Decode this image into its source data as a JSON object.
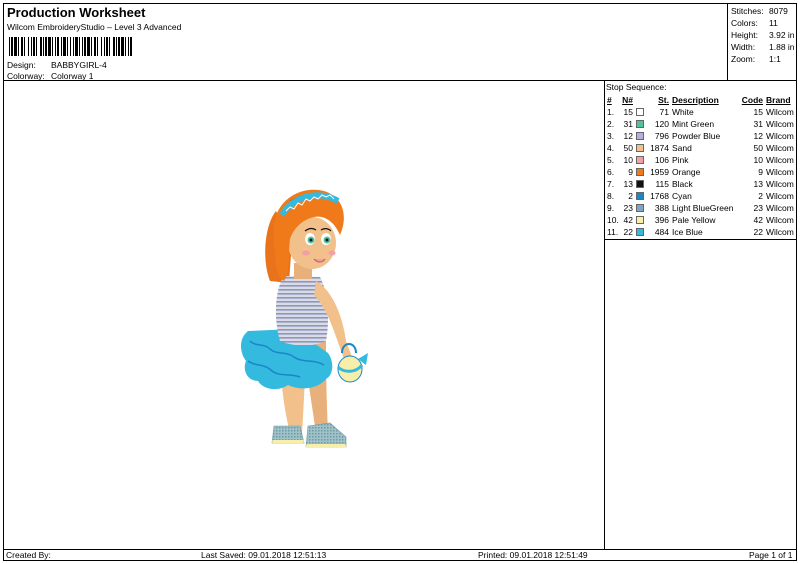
{
  "header": {
    "title": "Production Worksheet",
    "subtitle": "Wilcom EmbroideryStudio – Level 3 Advanced",
    "design_label": "Design:",
    "design_value": "BABBYGIRL-4",
    "colorway_label": "Colorway:",
    "colorway_value": "Colorway 1"
  },
  "stats": {
    "stitches_label": "Stitches:",
    "stitches_value": "8079",
    "colors_label": "Colors:",
    "colors_value": "11",
    "height_label": "Height:",
    "height_value": "3.92 in",
    "width_label": "Width:",
    "width_value": "1.88 in",
    "zoom_label": "Zoom:",
    "zoom_value": "1:1"
  },
  "sequence": {
    "title": "Stop Sequence:",
    "headers": {
      "idx": "#",
      "n": "N#",
      "st": "St.",
      "desc": "Description",
      "code": "Code",
      "brand": "Brand"
    },
    "rows": [
      {
        "idx": "1.",
        "n": "15",
        "color": "#ffffff",
        "st": "71",
        "desc": "White",
        "code": "15",
        "brand": "Wilcom"
      },
      {
        "idx": "2.",
        "n": "31",
        "color": "#4fc3a1",
        "st": "120",
        "desc": "Mint Green",
        "code": "31",
        "brand": "Wilcom"
      },
      {
        "idx": "3.",
        "n": "12",
        "color": "#b8b0dc",
        "st": "796",
        "desc": "Powder Blue",
        "code": "12",
        "brand": "Wilcom"
      },
      {
        "idx": "4.",
        "n": "50",
        "color": "#f4c08a",
        "st": "1874",
        "desc": "Sand",
        "code": "50",
        "brand": "Wilcom"
      },
      {
        "idx": "5.",
        "n": "10",
        "color": "#f2a0a8",
        "st": "106",
        "desc": "Pink",
        "code": "10",
        "brand": "Wilcom"
      },
      {
        "idx": "6.",
        "n": "9",
        "color": "#f07a1a",
        "st": "1959",
        "desc": "Orange",
        "code": "9",
        "brand": "Wilcom"
      },
      {
        "idx": "7.",
        "n": "13",
        "color": "#111111",
        "st": "115",
        "desc": "Black",
        "code": "13",
        "brand": "Wilcom"
      },
      {
        "idx": "8.",
        "n": "2",
        "color": "#1a86c8",
        "st": "1768",
        "desc": "Cyan",
        "code": "2",
        "brand": "Wilcom"
      },
      {
        "idx": "9.",
        "n": "23",
        "color": "#7fa6c4",
        "st": "388",
        "desc": "Light BlueGreen",
        "code": "23",
        "brand": "Wilcom"
      },
      {
        "idx": "10.",
        "n": "42",
        "color": "#f7eeaa",
        "st": "396",
        "desc": "Pale Yellow",
        "code": "42",
        "brand": "Wilcom"
      },
      {
        "idx": "11.",
        "n": "22",
        "color": "#34b9df",
        "st": "484",
        "desc": "Ice Blue",
        "code": "22",
        "brand": "Wilcom"
      }
    ]
  },
  "footer": {
    "created": "Created By:",
    "saved": "Last Saved: 09.01.2018 12:51:13",
    "printed": "Printed: 09.01.2018 12:51:49",
    "page": "Page 1 of 1"
  }
}
